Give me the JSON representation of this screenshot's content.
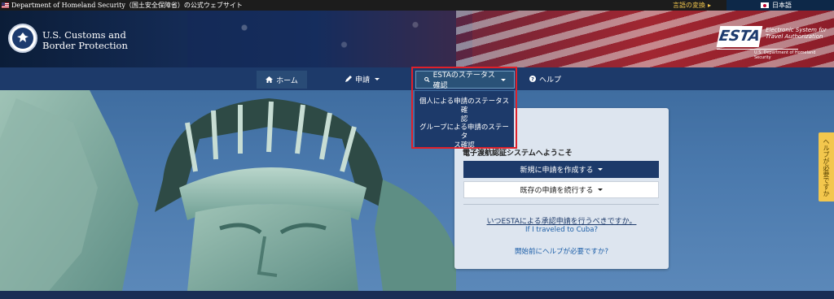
{
  "topbar": {
    "gov_text": "Department of Homeland Security（国土安全保障省）の公式ウェブサイト",
    "lang_switch": "言語の変換",
    "lang_selected": "日本語"
  },
  "header": {
    "agency_line1": "U.S. Customs and",
    "agency_line2": "Border Protection",
    "esta_logo": "ESTA",
    "esta_line1": "Electronic System for",
    "esta_line2": "Travel Authorization",
    "esta_sub": "U.S. Department of Homeland Security"
  },
  "nav": {
    "home": "ホーム",
    "apply": "申請",
    "status": "ESTAのステータス確認",
    "help": "ヘルプ"
  },
  "dropdown": {
    "items": [
      {
        "line1": "個人による申請のステータス確",
        "line2": "認"
      },
      {
        "line1": "グループによる申請のステータ",
        "line2": "ス確認"
      }
    ]
  },
  "panel": {
    "partial_heading": "ii",
    "welcome": "電子渡航認証システムへようこそ",
    "btn_new": "新規に申請を作成する",
    "btn_continue": "既存の申請を続行する",
    "link_when": "いつESTAによる承認申請を行うべきですか。",
    "link_cuba": "If I traveled to Cuba?",
    "link_help": "開始前にヘルプが必要ですか?"
  },
  "side_tab": "ヘルプが必要ですか",
  "colors": {
    "nav_bg": "#1d3a6a",
    "highlight_border": "#e0202a",
    "side_tab": "#f3c74d"
  }
}
